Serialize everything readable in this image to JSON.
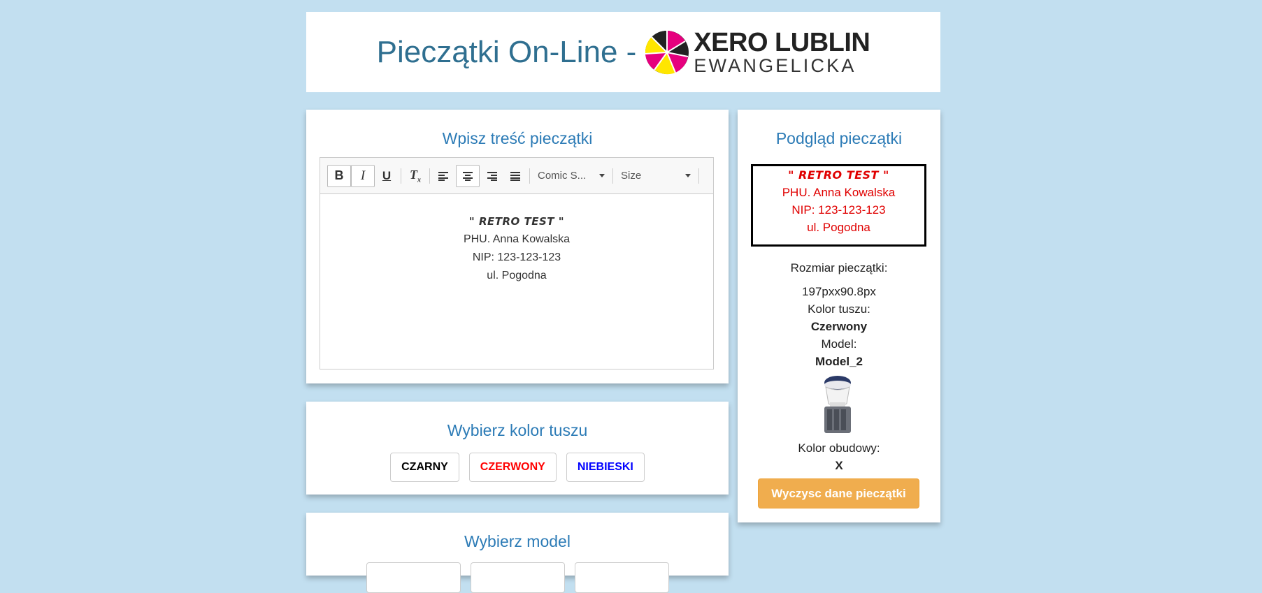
{
  "header": {
    "title": "Pieczątki On-Line -",
    "logo_line1": "XERO LUBLIN",
    "logo_line2": "EWANGELICKA"
  },
  "editor": {
    "title": "Wpisz treść pieczątki",
    "font_select": "Comic S...",
    "size_select": "Size",
    "content": [
      "\" RETRO TEST \"",
      "PHU. Anna Kowalska",
      "NIP: 123-123-123",
      "ul. Pogodna"
    ]
  },
  "ink": {
    "title": "Wybierz kolor tuszu",
    "buttons": [
      {
        "label": "CZARNY",
        "color": "#000000"
      },
      {
        "label": "CZERWONY",
        "color": "#ff0000"
      },
      {
        "label": "NIEBIESKI",
        "color": "#0000ff"
      }
    ]
  },
  "model": {
    "title": "Wybierz model"
  },
  "preview": {
    "title": "Podgląd pieczątki",
    "stamp_lines": [
      "\" RETRO TEST \"",
      "PHU. Anna Kowalska",
      "NIP: 123-123-123",
      "ul. Pogodna"
    ],
    "stamp_color": "#e00000",
    "size_label": "Rozmiar pieczątki:",
    "size_value": "197pxx90.8px",
    "ink_label": "Kolor tuszu:",
    "ink_value": "Czerwony",
    "model_label": "Model:",
    "model_value": "Model_2",
    "housing_label": "Kolor obudowy:",
    "housing_value": "X",
    "clear_button": "Wyczysc dane pieczątki"
  }
}
